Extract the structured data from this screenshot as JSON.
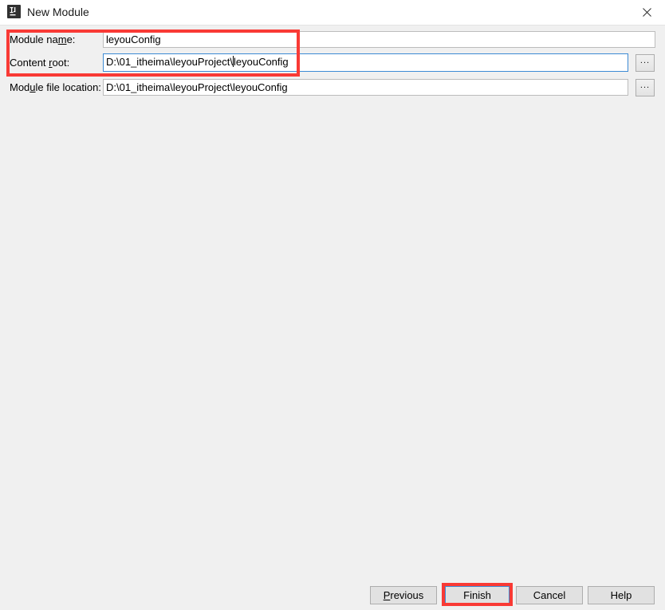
{
  "window": {
    "title": "New Module",
    "icon": "intellij-idea-logo-icon",
    "close_icon": "close-icon",
    "titlebar_bg": "#ffffff",
    "body_bg": "#f0f0f0"
  },
  "form": {
    "rows": [
      {
        "label_before": "Module na",
        "label_mnemonic": "m",
        "label_after": "e:",
        "value": "leyouConfig",
        "placeholder": "",
        "focused": false,
        "has_browse": false,
        "browse_label": "..."
      },
      {
        "label_before": "Content ",
        "label_mnemonic": "r",
        "label_after": "oot:",
        "value_before_caret": "D:\\01_itheima\\leyouProject\\",
        "value_after_caret": "leyouConfig",
        "value": "D:\\01_itheima\\leyouProject\\leyouConfig",
        "placeholder": "",
        "focused": true,
        "has_browse": true,
        "browse_label": "..."
      },
      {
        "label_before": "Mod",
        "label_mnemonic": "u",
        "label_after": "le file location:",
        "value": "D:\\01_itheima\\leyouProject\\leyouConfig",
        "placeholder": "",
        "focused": false,
        "has_browse": true,
        "browse_label": "..."
      }
    ]
  },
  "buttons": {
    "previous": {
      "before": "",
      "mnemonic": "P",
      "after": "revious",
      "label": "Previous"
    },
    "finish": {
      "label": "Finish",
      "focused": true
    },
    "cancel": {
      "label": "Cancel"
    },
    "help": {
      "label": "Help"
    }
  },
  "annotations": {
    "color": "#f93a35",
    "fields_box": "highlight-module-name-and-content-root",
    "finish_box": "highlight-finish-button"
  }
}
